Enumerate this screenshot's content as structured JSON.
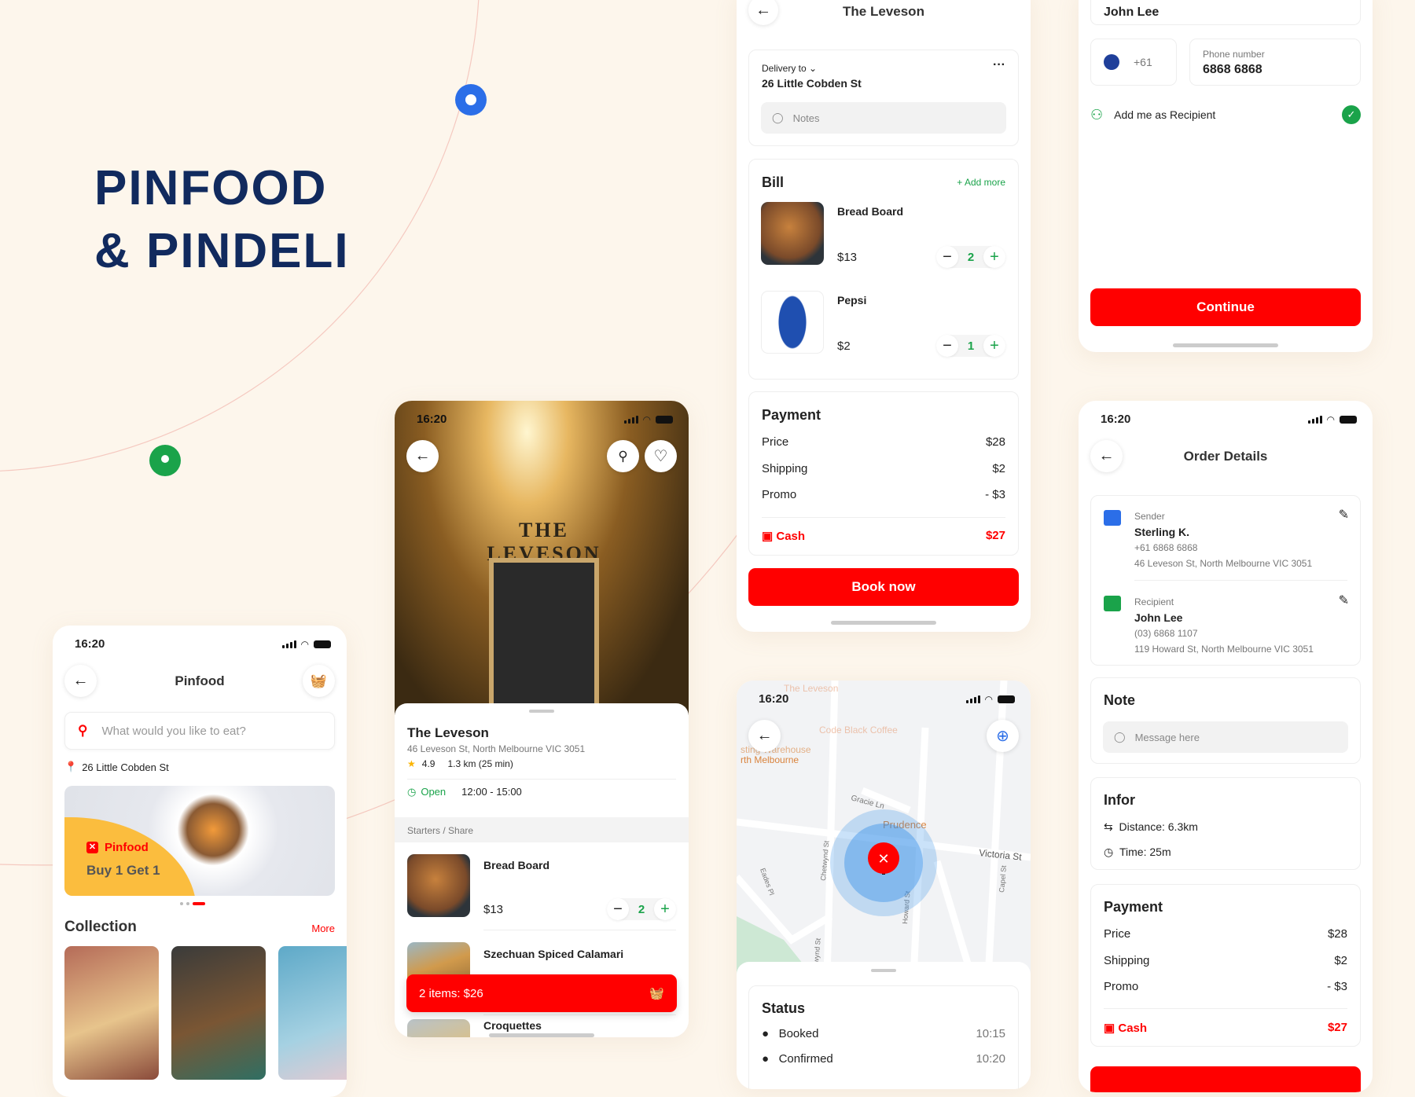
{
  "brand": {
    "line1": "PINFOOD",
    "line2": "& PINDELI",
    "color": "#112a5e"
  },
  "colors": {
    "accent": "#ff0000",
    "green": "#1aa34a",
    "banner": "#fbbd3e",
    "map_blue": "#2b6ee8"
  },
  "status_time": "16:20",
  "pinfood": {
    "title": "Pinfood",
    "search_placeholder": "What would you like to eat?",
    "address": "26 Little Cobden St",
    "banner_brand": "Pinfood",
    "banner_offer": "Buy 1 Get 1",
    "carousel_active": 3,
    "carousel_count": 3,
    "collection_title": "Collection",
    "more_label": "More"
  },
  "restaurant": {
    "sign": "THE LEVESON",
    "name": "The Leveson",
    "address": "46 Leveson St, North Melbourne VIC 3051",
    "rating": "4.9",
    "distance": "1.3 km (25 min)",
    "open_label": "Open",
    "hours": "12:00 - 15:00",
    "section": "Starters / Share",
    "items": [
      {
        "name": "Bread Board",
        "price": "$13",
        "qty": "2"
      },
      {
        "name": "Szechuan Spiced Calamari"
      },
      {
        "name": "Croquettes"
      }
    ],
    "cart_label": "2 items: $26"
  },
  "checkout": {
    "title": "The Leveson",
    "delivery_label": "Delivery to",
    "address": "26 Little Cobden St",
    "notes_placeholder": "Notes",
    "bill_title": "Bill",
    "add_more": "+ Add more",
    "bill_items": [
      {
        "name": "Bread Board",
        "price": "$13",
        "qty": "2"
      },
      {
        "name": "Pepsi",
        "price": "$2",
        "qty": "1"
      }
    ],
    "payment_title": "Payment",
    "rows": [
      {
        "label": "Price",
        "value": "$28"
      },
      {
        "label": "Shipping",
        "value": "$2"
      },
      {
        "label": "Promo",
        "value": "- $3"
      }
    ],
    "method": "Cash",
    "total": "$27",
    "book_label": "Book now"
  },
  "map": {
    "labels": {
      "leveson": "The Leveson",
      "coffee": "Code Black Coffee",
      "warehouse": "sting Warehouse",
      "north": "rth Melbourne",
      "gracie": "Gracie Ln",
      "prudence": "Prudence",
      "victoria": "Victoria St",
      "chetwynd": "Chetwynd St",
      "eades": "Eades Pl",
      "howard": "Howard St",
      "capel": "Capel St",
      "wynd": "wynd St"
    },
    "status_title": "Status",
    "statuses": [
      {
        "label": "Booked",
        "time": "10:15"
      },
      {
        "label": "Confirmed",
        "time": "10:20"
      }
    ]
  },
  "recipient": {
    "name_value": "John Lee",
    "country_code": "+61",
    "phone_label": "Phone number",
    "phone_value": "6868 6868",
    "add_me": "Add me as Recipient",
    "add_me_checked": true,
    "continue_label": "Continue"
  },
  "order": {
    "title": "Order Details",
    "sender": {
      "label": "Sender",
      "name": "Sterling K.",
      "phone": "+61 6868 6868",
      "address": "46 Leveson St, North Melbourne VIC 3051"
    },
    "recipient": {
      "label": "Recipient",
      "name": "John Lee",
      "phone": "(03) 6868 1107",
      "address": "119 Howard St, North Melbourne VIC 3051"
    },
    "note_title": "Note",
    "note_placeholder": "Message here",
    "info_title": "Infor",
    "distance": "Distance: 6.3km",
    "time": "Time: 25m",
    "payment_title": "Payment",
    "rows": [
      {
        "label": "Price",
        "value": "$28"
      },
      {
        "label": "Shipping",
        "value": "$2"
      },
      {
        "label": "Promo",
        "value": "- $3"
      }
    ],
    "method": "Cash",
    "total": "$27"
  }
}
